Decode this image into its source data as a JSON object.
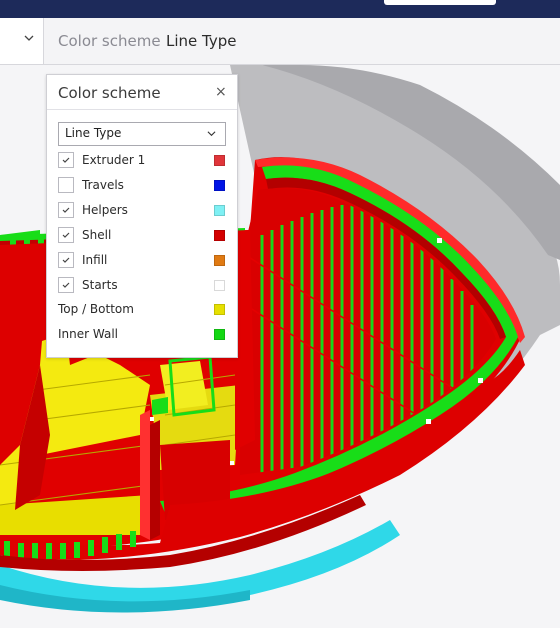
{
  "header": {
    "label": "Color scheme",
    "value": "Line Type"
  },
  "panel": {
    "title": "Color scheme",
    "close_glyph": "×",
    "select_value": "Line Type",
    "items": [
      {
        "label": "Extruder 1",
        "checked": true,
        "color": "#e0353a",
        "has_checkbox": true
      },
      {
        "label": "Travels",
        "checked": false,
        "color": "#0014e6",
        "has_checkbox": true
      },
      {
        "label": "Helpers",
        "checked": true,
        "color": "#7ff0f4",
        "has_checkbox": true
      },
      {
        "label": "Shell",
        "checked": true,
        "color": "#d40000",
        "has_checkbox": true
      },
      {
        "label": "Infill",
        "checked": true,
        "color": "#e07a12",
        "has_checkbox": true
      },
      {
        "label": "Starts",
        "checked": true,
        "color": "#ffffff",
        "has_checkbox": true
      },
      {
        "label": "Top / Bottom",
        "checked": null,
        "color": "#e6e000",
        "has_checkbox": false
      },
      {
        "label": "Inner Wall",
        "checked": null,
        "color": "#14d814",
        "has_checkbox": false
      }
    ]
  },
  "icons": {
    "header_dropdown": "chevron-down-icon",
    "select_dropdown": "chevron-down-icon",
    "close": "close-icon",
    "checkbox_tick": "check-icon"
  }
}
